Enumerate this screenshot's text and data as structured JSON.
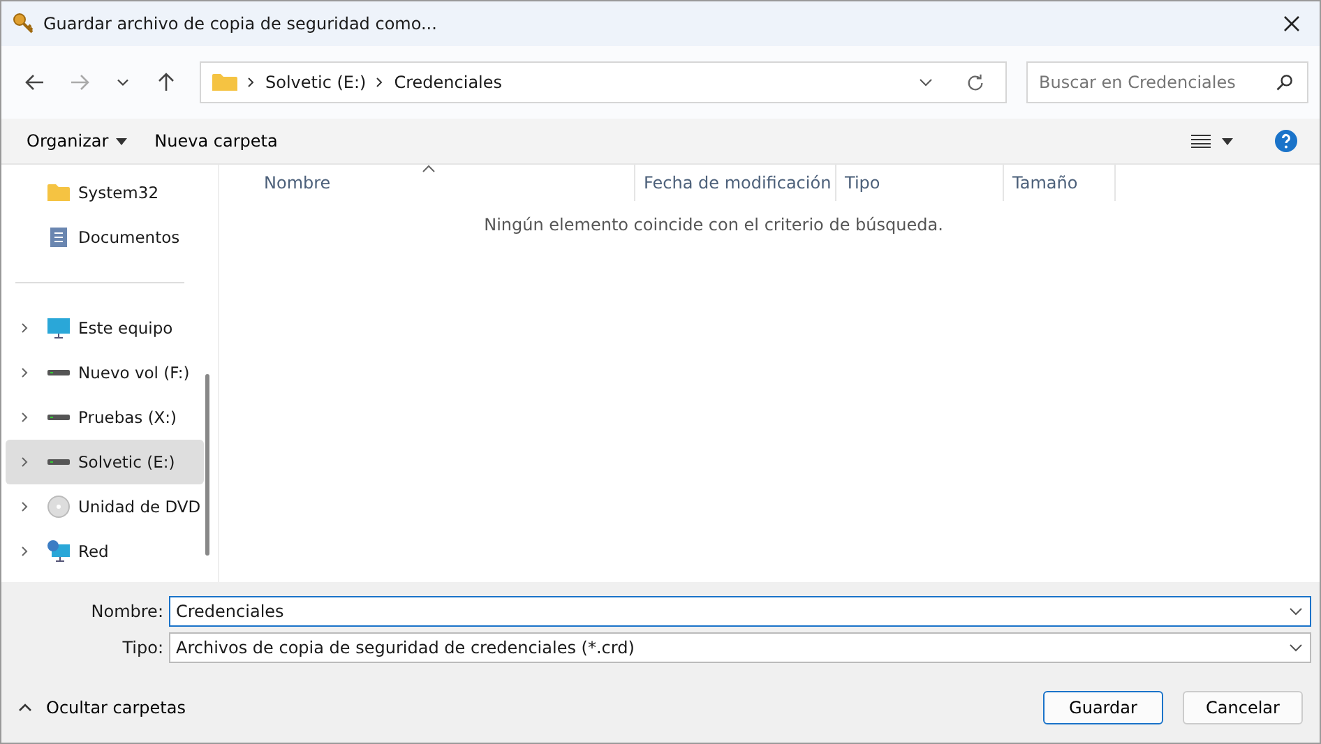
{
  "window": {
    "title": "Guardar archivo de copia de seguridad como..."
  },
  "address": {
    "crumbs": [
      "Solvetic (E:)",
      "Credenciales"
    ]
  },
  "search": {
    "placeholder": "Buscar en Credenciales"
  },
  "commands": {
    "organize": "Organizar",
    "new_folder": "Nueva carpeta"
  },
  "sidebar": {
    "items": [
      {
        "label": "System32",
        "kind": "folder",
        "expandable": false,
        "selected": false
      },
      {
        "label": "Documentos",
        "kind": "document",
        "expandable": false,
        "selected": false
      },
      {
        "label": "Este equipo",
        "kind": "pc",
        "expandable": true,
        "selected": false
      },
      {
        "label": "Nuevo vol (F:)",
        "kind": "drive",
        "expandable": true,
        "selected": false
      },
      {
        "label": "Pruebas (X:)",
        "kind": "drive",
        "expandable": true,
        "selected": false
      },
      {
        "label": "Solvetic (E:)",
        "kind": "drive",
        "expandable": true,
        "selected": true
      },
      {
        "label": "Unidad de DVD",
        "kind": "dvd",
        "expandable": true,
        "selected": false
      },
      {
        "label": "Red",
        "kind": "network",
        "expandable": true,
        "selected": false
      }
    ]
  },
  "table": {
    "columns": [
      "Nombre",
      "Fecha de modificación",
      "Tipo",
      "Tamaño"
    ],
    "empty_message": "Ningún elemento coincide con el criterio de búsqueda."
  },
  "form": {
    "name_label": "Nombre:",
    "name_value": "Credenciales",
    "type_label": "Tipo:",
    "type_value": "Archivos de copia de seguridad de credenciales (*.crd)"
  },
  "footer": {
    "toggle": "Ocultar carpetas",
    "buttons": [
      "Guardar",
      "Cancelar"
    ]
  }
}
